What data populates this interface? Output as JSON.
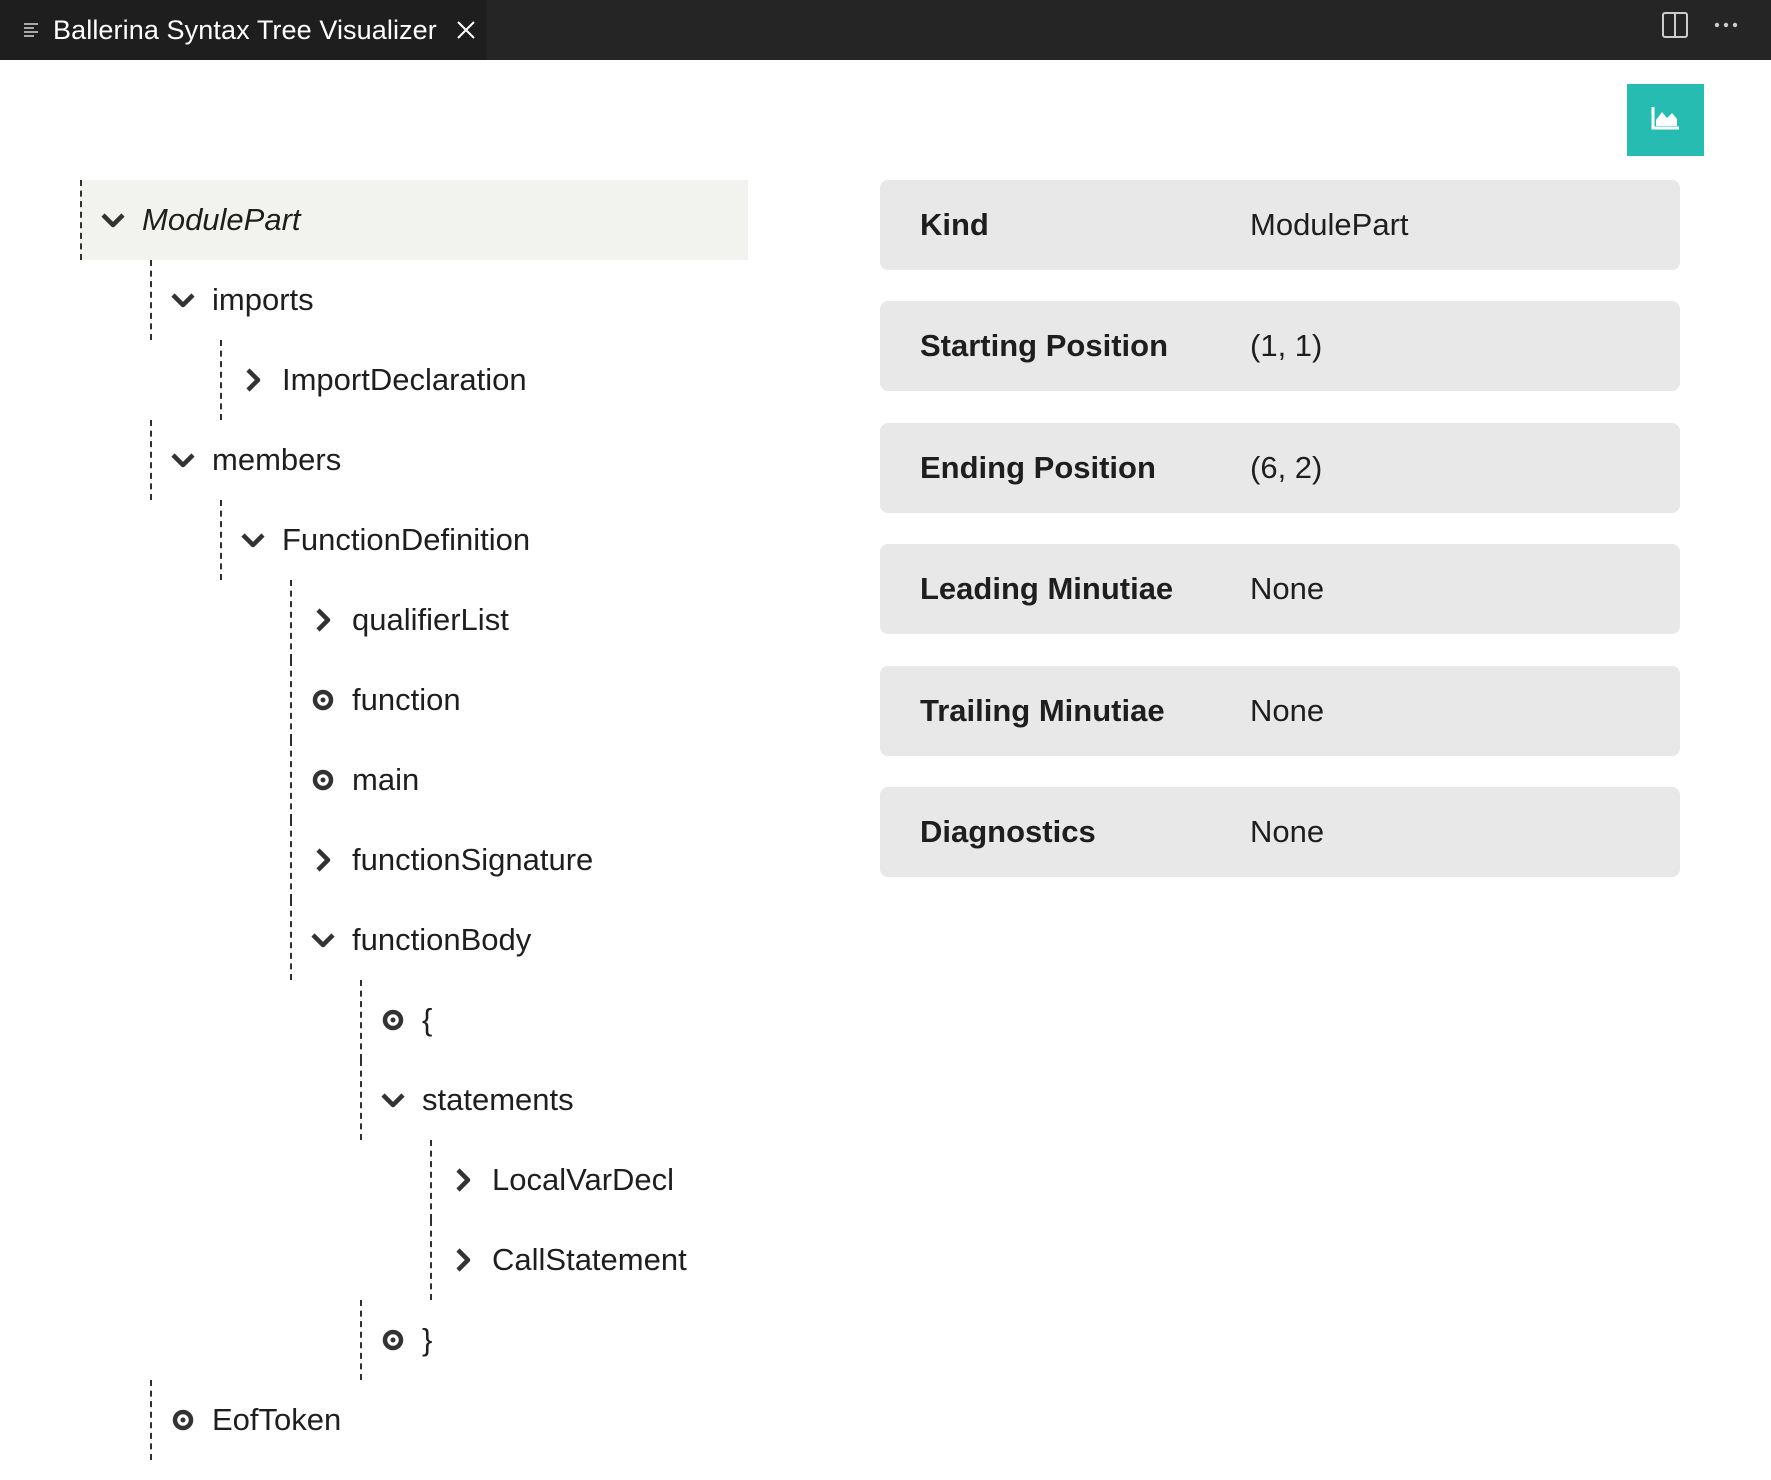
{
  "tab": {
    "title": "Ballerina Syntax Tree Visualizer"
  },
  "toolbar": {
    "icons": [
      "preview-list-icon",
      "close-icon",
      "split-editor-icon",
      "more-actions-icon"
    ],
    "chart_button_icon": "area-chart-icon",
    "chart_button_color": "#26bcb2"
  },
  "tree": {
    "nodes": [
      {
        "label": "ModulePart",
        "depth": 0,
        "icon": "chevron-down",
        "selected": true
      },
      {
        "label": "imports",
        "depth": 1,
        "icon": "chevron-down"
      },
      {
        "label": "ImportDeclaration",
        "depth": 2,
        "icon": "chevron-right"
      },
      {
        "label": "members",
        "depth": 1,
        "icon": "chevron-down"
      },
      {
        "label": "FunctionDefinition",
        "depth": 2,
        "icon": "chevron-down"
      },
      {
        "label": "qualifierList",
        "depth": 3,
        "icon": "chevron-right"
      },
      {
        "label": "function",
        "depth": 3,
        "icon": "token-dot"
      },
      {
        "label": "main",
        "depth": 3,
        "icon": "token-dot"
      },
      {
        "label": "functionSignature",
        "depth": 3,
        "icon": "chevron-right"
      },
      {
        "label": "functionBody",
        "depth": 3,
        "icon": "chevron-down"
      },
      {
        "label": "{",
        "depth": 4,
        "icon": "token-dot"
      },
      {
        "label": "statements",
        "depth": 4,
        "icon": "chevron-down"
      },
      {
        "label": "LocalVarDecl",
        "depth": 5,
        "icon": "chevron-right"
      },
      {
        "label": "CallStatement",
        "depth": 5,
        "icon": "chevron-right"
      },
      {
        "label": "}",
        "depth": 4,
        "icon": "token-dot"
      },
      {
        "label": "EofToken",
        "depth": 1,
        "icon": "token-dot"
      }
    ]
  },
  "properties": [
    {
      "key": "Kind",
      "value": "ModulePart"
    },
    {
      "key": "Starting Position",
      "value": "(1, 1)"
    },
    {
      "key": "Ending Position",
      "value": "(6, 2)"
    },
    {
      "key": "Leading Minutiae",
      "value": "None"
    },
    {
      "key": "Trailing Minutiae",
      "value": "None"
    },
    {
      "key": "Diagnostics",
      "value": "None"
    }
  ]
}
